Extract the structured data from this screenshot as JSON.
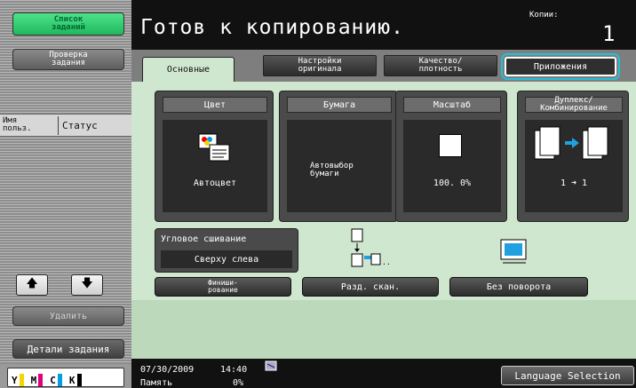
{
  "sidebar": {
    "job_list_label": "Список заданий",
    "job_check_label": "Проверка задания",
    "col_user": "Имя польз.",
    "col_status": "Статус",
    "delete_label": "Удалить",
    "job_details_label": "Детали задания",
    "toner": [
      {
        "letter": "Y",
        "color": "#f5d400"
      },
      {
        "letter": "M",
        "color": "#e0007a"
      },
      {
        "letter": "C",
        "color": "#00a0e0"
      },
      {
        "letter": "K",
        "color": "#000000"
      }
    ]
  },
  "header": {
    "title": "Готов к копированию.",
    "copies_label": "Копии:",
    "copies_value": "1"
  },
  "tabs": [
    {
      "label": "Основные"
    },
    {
      "label": "Настройки оригинала"
    },
    {
      "label": "Качество/ плотность"
    },
    {
      "label": "Приложения"
    }
  ],
  "functions": {
    "color": {
      "title": "Цвет",
      "value": "Автоцвет"
    },
    "paper": {
      "title": "Бумага",
      "value": "Автовыбор бумаги"
    },
    "zoom": {
      "title": "Масштаб",
      "value": "100. 0%"
    },
    "duplex": {
      "title": "Дуплекс/ Комбинирование",
      "value": "1 ➜ 1"
    }
  },
  "staple": {
    "title": "Угловое сшивание",
    "value": "Сверху слева"
  },
  "bottom_buttons": {
    "finishing": "Финиши- рование",
    "separate_scan": "Разд. скан.",
    "no_rotation": "Без поворота"
  },
  "status_bar": {
    "date": "07/30/2009",
    "time": "14:40",
    "memory_label": "Память",
    "memory_value": "0%",
    "language_button": "Language Selection"
  },
  "accent_color": "#20c0d8"
}
